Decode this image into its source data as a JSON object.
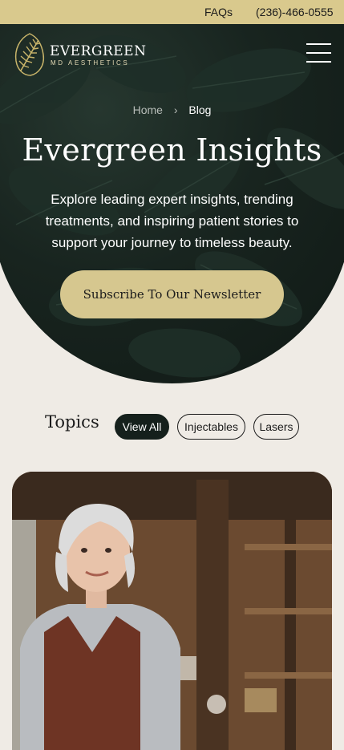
{
  "topbar": {
    "faq_label": "FAQs",
    "phone": "(236)-466-0555",
    "background": "#d9c98d"
  },
  "header": {
    "brand_name": "EVERGREEN",
    "brand_sub": "MD AESTHETICS",
    "logo_icon": "fern-leaf-icon",
    "menu_icon": "hamburger-menu-icon"
  },
  "breadcrumb": {
    "home": "Home",
    "separator": "›",
    "current": "Blog"
  },
  "hero": {
    "title": "Evergreen Insights",
    "intro": "Explore leading expert insights, trending treatments, and inspiring patient stories to support your journey to timeless beauty.",
    "subscribe_label": "Subscribe To Our Newsletter",
    "background": "#18241f",
    "accent": "#d6c78f"
  },
  "topics": {
    "title": "Topics",
    "chips": [
      {
        "label": "View All",
        "active": true
      },
      {
        "label": "Injectables",
        "active": false
      },
      {
        "label": "Lasers",
        "active": false
      }
    ]
  },
  "featured_image": {
    "alt_icon": "portrait-photo-older-woman-icon"
  }
}
